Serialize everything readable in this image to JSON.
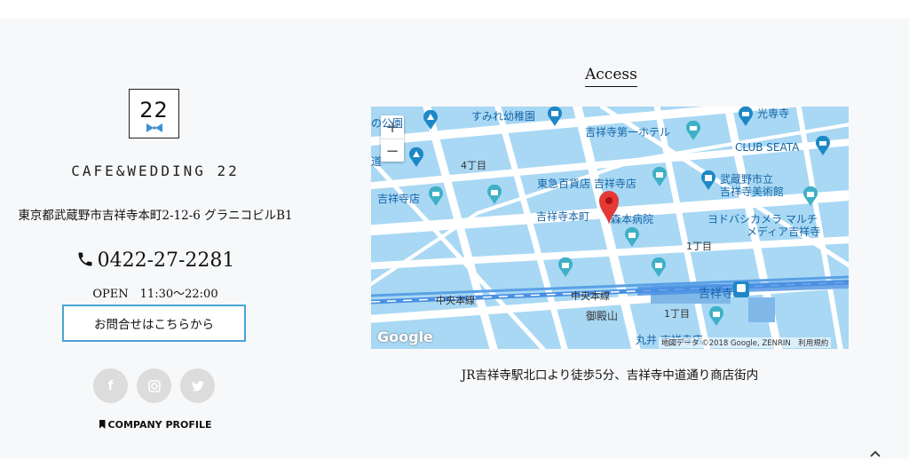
{
  "shop": {
    "logo_number": "22",
    "brand": "CAFE&WEDDING 22",
    "address": "東京都武蔵野市吉祥寺本町2-12-6 グラニコビルB1",
    "phone": "0422-27-2281",
    "hours": "OPEN　11:30～22:00",
    "contact_button": "お問合せはこちらから",
    "company_profile": "COMPANY PROFILE"
  },
  "social": [
    {
      "icon": "facebook-icon",
      "glyph": "f"
    },
    {
      "icon": "instagram-icon",
      "glyph": "◎"
    },
    {
      "icon": "twitter-icon",
      "glyph": "🐦"
    }
  ],
  "access": {
    "title": "Access",
    "directions": "JR吉祥寺駅北口より徒歩5分、吉祥寺中道通り商店街内"
  },
  "map": {
    "zoom_in": "+",
    "zoom_out": "−",
    "labels": {
      "sumire": "すみれ幼稚園",
      "daiichi_hotel": "吉祥寺第一ホテル",
      "koushoji": "光専寺",
      "club_seata": "CLUB SEATA",
      "park": "の公園",
      "michi": "道",
      "yonchome": "4丁目",
      "tokyu": "東急百貨店 吉祥寺店",
      "musashino_museum_1": "武蔵野市立",
      "musashino_museum_2": "吉祥寺美術館",
      "kichijoji_store": "吉祥寺店",
      "honcho": "吉祥寺本町",
      "hospital": "森本病院",
      "yodobashi_1": "ヨドバシカメラ マルチ",
      "yodobashi_2": "メディア吉祥寺",
      "itchome_1": "1丁目",
      "chuo_line_1": "中央本線",
      "chuo_line_2": "中央本線",
      "station": "吉祥寺",
      "gotenyama": "御殿山",
      "itchome_2": "1丁目",
      "marui": "丸井 吉祥寺店"
    },
    "google": "Google",
    "attribution": "地図データ ©2018 Google, ZENRIN　利用規約"
  },
  "colors": {
    "accent": "#4aa3d6",
    "map_water": "#a8d8f4",
    "map_road": "#ffffff",
    "rail": "#4a90e2",
    "marker": "#e53935"
  }
}
